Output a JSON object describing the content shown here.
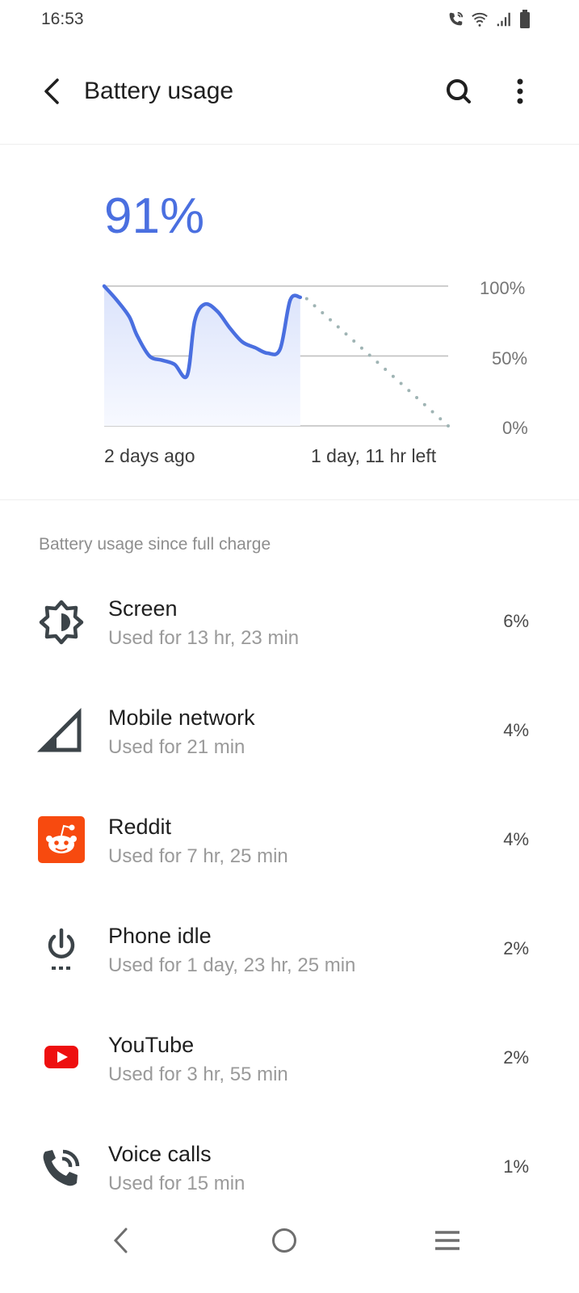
{
  "status_bar": {
    "time": "16:53",
    "icons": [
      "wifi-calling-icon",
      "wifi-icon",
      "signal-icon",
      "battery-icon"
    ]
  },
  "app_bar": {
    "title": "Battery usage",
    "back_icon": "back-arrow-icon",
    "search_icon": "search-icon",
    "more_icon": "more-vert-icon"
  },
  "battery": {
    "level": "91%",
    "accent_color": "#4a6fe0"
  },
  "chart_data": {
    "type": "line",
    "title": "",
    "y_ticks": [
      "100%",
      "50%",
      "0%"
    ],
    "ylim": [
      0,
      100
    ],
    "x_start_label": "2 days ago",
    "x_end_label": "1 day, 11 hr left",
    "history": {
      "name": "Battery level",
      "x": [
        0,
        0.05,
        0.1,
        0.13,
        0.18,
        0.23,
        0.28,
        0.33,
        0.36,
        0.4,
        0.45,
        0.5,
        0.55,
        0.6,
        0.65,
        0.7,
        0.74,
        0.78
      ],
      "y": [
        100,
        90,
        78,
        65,
        50,
        47,
        44,
        36,
        75,
        87,
        82,
        70,
        60,
        56,
        52,
        55,
        90,
        92
      ]
    },
    "projection": {
      "name": "Predicted",
      "x": [
        0.78,
        1.0
      ],
      "y": [
        91,
        0
      ]
    },
    "x_range_fraction_history": 0.57,
    "grid": true,
    "line_color": "#4a6fe0",
    "projection_color": "#9fb4b4"
  },
  "section": {
    "header": "Battery usage since full charge"
  },
  "usage_items": [
    {
      "icon": "brightness-icon",
      "title": "Screen",
      "subtitle": "Used for 13 hr, 23 min",
      "percent": "6%"
    },
    {
      "icon": "cell-signal-icon",
      "title": "Mobile network",
      "subtitle": "Used for 21 min",
      "percent": "4%"
    },
    {
      "icon": "reddit-icon",
      "title": "Reddit",
      "subtitle": "Used for 7 hr, 25 min",
      "percent": "4%"
    },
    {
      "icon": "power-idle-icon",
      "title": "Phone idle",
      "subtitle": "Used for 1 day, 23 hr, 25 min",
      "percent": "2%"
    },
    {
      "icon": "youtube-icon",
      "title": "YouTube",
      "subtitle": "Used for 3 hr, 55 min",
      "percent": "2%"
    },
    {
      "icon": "voice-call-icon",
      "title": "Voice calls",
      "subtitle": "Used for 15 min",
      "percent": "1%"
    }
  ],
  "nav_bar": {
    "back": "nav-back-icon",
    "home": "nav-home-icon",
    "recents": "nav-recents-icon"
  }
}
